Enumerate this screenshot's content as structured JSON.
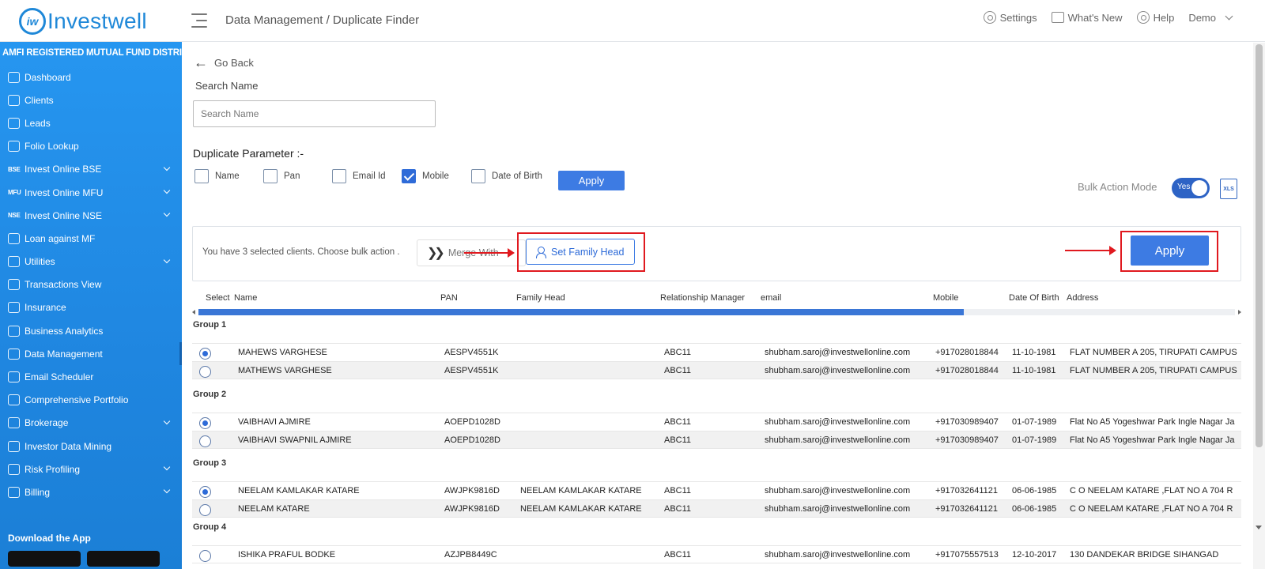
{
  "app": {
    "logo_mark": "iw",
    "logo_text": "Investwell",
    "breadcrumb": "Data Management / Duplicate Finder"
  },
  "topnav": {
    "settings": "Settings",
    "whats_new": "What's New",
    "help": "Help",
    "user": "Demo"
  },
  "sidebar": {
    "tagline": "AMFI REGISTERED MUTUAL FUND DISTRIBUTOR",
    "items": [
      {
        "label": "Dashboard",
        "tag": "",
        "expandable": false
      },
      {
        "label": "Clients",
        "tag": "",
        "expandable": false
      },
      {
        "label": "Leads",
        "tag": "",
        "expandable": false
      },
      {
        "label": "Folio Lookup",
        "tag": "",
        "expandable": false
      },
      {
        "label": "Invest Online BSE",
        "tag": "BSE",
        "expandable": true
      },
      {
        "label": "Invest Online MFU",
        "tag": "MFU",
        "expandable": true
      },
      {
        "label": "Invest Online NSE",
        "tag": "NSE",
        "expandable": true
      },
      {
        "label": "Loan against MF",
        "tag": "",
        "expandable": false
      },
      {
        "label": "Utilities",
        "tag": "",
        "expandable": true
      },
      {
        "label": "Transactions View",
        "tag": "",
        "expandable": false
      },
      {
        "label": "Insurance",
        "tag": "",
        "expandable": false
      },
      {
        "label": "Business Analytics",
        "tag": "",
        "expandable": false
      },
      {
        "label": "Data Management",
        "tag": "",
        "expandable": false,
        "active": true
      },
      {
        "label": "Email Scheduler",
        "tag": "",
        "expandable": false
      },
      {
        "label": "Comprehensive Portfolio",
        "tag": "",
        "expandable": false
      },
      {
        "label": "Brokerage",
        "tag": "",
        "expandable": true
      },
      {
        "label": "Investor Data Mining",
        "tag": "",
        "expandable": false
      },
      {
        "label": "Risk Profiling",
        "tag": "",
        "expandable": true
      },
      {
        "label": "Billing",
        "tag": "",
        "expandable": true
      }
    ],
    "download_app": "Download the App"
  },
  "page": {
    "go_back": "Go Back",
    "search_label": "Search Name",
    "search_placeholder": "Search Name",
    "search_value": "",
    "duplicate_parameter_label": "Duplicate Parameter :-",
    "params": [
      {
        "label": "Name",
        "checked": false
      },
      {
        "label": "Pan",
        "checked": false
      },
      {
        "label": "Email Id",
        "checked": false
      },
      {
        "label": "Mobile",
        "checked": true
      },
      {
        "label": "Date of Birth",
        "checked": false
      }
    ],
    "apply_small": "Apply",
    "bulk_action_mode_label": "Bulk Action Mode",
    "bulk_action_mode_value": "Yes",
    "xls_label": "XLS"
  },
  "bulk": {
    "message": "You have 3 selected clients. Choose bulk action .",
    "merge_with": "Merge With",
    "set_family_head": "Set Family Head",
    "apply": "Apply"
  },
  "table": {
    "headers": [
      "Select",
      "Name",
      "PAN",
      "Family Head",
      "Relationship Manager",
      "email",
      "Mobile",
      "Date Of Birth",
      "Address"
    ],
    "groups": [
      {
        "label": "Group 1",
        "rows": [
          {
            "selected": true,
            "name": "MAHEWS VARGHESE",
            "pan": "AESPV4551K",
            "family_head": "",
            "rm": "ABC11",
            "email": "shubham.saroj@investwellonline.com",
            "mobile": "+917028018844",
            "dob": "11-10-1981",
            "address": "FLAT NUMBER A 205, TIRUPATI CAMPUS"
          },
          {
            "selected": false,
            "name": "MATHEWS VARGHESE",
            "pan": "AESPV4551K",
            "family_head": "",
            "rm": "ABC11",
            "email": "shubham.saroj@investwellonline.com",
            "mobile": "+917028018844",
            "dob": "11-10-1981",
            "address": "FLAT NUMBER A 205, TIRUPATI CAMPUS"
          }
        ]
      },
      {
        "label": "Group 2",
        "rows": [
          {
            "selected": true,
            "name": "VAIBHAVI AJMIRE",
            "pan": "AOEPD1028D",
            "family_head": "",
            "rm": "ABC11",
            "email": "shubham.saroj@investwellonline.com",
            "mobile": "+917030989407",
            "dob": "01-07-1989",
            "address": "Flat No A5 Yogeshwar Park Ingle Nagar Ja"
          },
          {
            "selected": false,
            "name": "VAIBHAVI SWAPNIL AJMIRE",
            "pan": "AOEPD1028D",
            "family_head": "",
            "rm": "ABC11",
            "email": "shubham.saroj@investwellonline.com",
            "mobile": "+917030989407",
            "dob": "01-07-1989",
            "address": "Flat No A5 Yogeshwar Park Ingle Nagar Ja"
          }
        ]
      },
      {
        "label": "Group 3",
        "rows": [
          {
            "selected": true,
            "name": "NEELAM KAMLAKAR KATARE",
            "pan": "AWJPK9816D",
            "family_head": "NEELAM KAMLAKAR KATARE",
            "rm": "ABC11",
            "email": "shubham.saroj@investwellonline.com",
            "mobile": "+917032641121",
            "dob": "06-06-1985",
            "address": "C O NEELAM KATARE ,FLAT NO A 704 R"
          },
          {
            "selected": false,
            "name": "NEELAM KATARE",
            "pan": "AWJPK9816D",
            "family_head": "NEELAM KAMLAKAR KATARE",
            "rm": "ABC11",
            "email": "shubham.saroj@investwellonline.com",
            "mobile": "+917032641121",
            "dob": "06-06-1985",
            "address": "C O NEELAM KATARE ,FLAT NO A 704 R"
          }
        ]
      },
      {
        "label": "Group 4",
        "rows": [
          {
            "selected": false,
            "name": "ISHIKA PRAFUL BODKE",
            "pan": "AZJPB8449C",
            "family_head": "",
            "rm": "ABC11",
            "email": "shubham.saroj@investwellonline.com",
            "mobile": "+917075557513",
            "dob": "12-10-2017",
            "address": "130 DANDEKAR BRIDGE SIHANGAD"
          }
        ]
      }
    ]
  }
}
